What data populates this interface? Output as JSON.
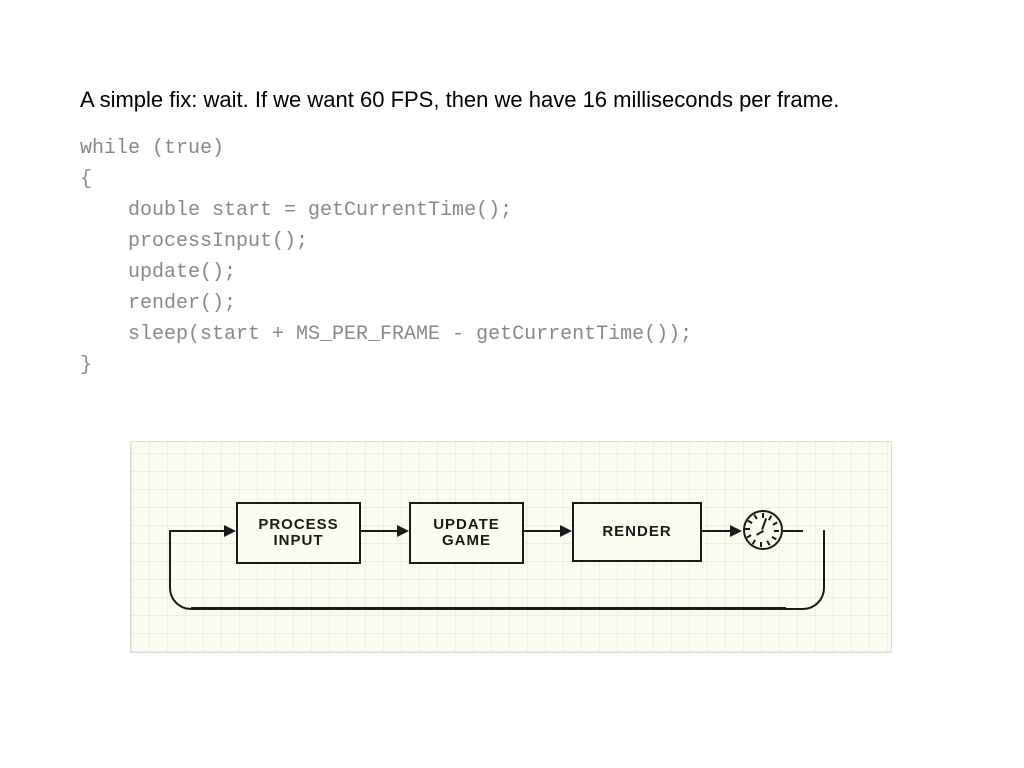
{
  "text": {
    "paragraph": "A simple fix: wait.  If we want 60 FPS, then we have 16 milliseconds per frame."
  },
  "code": {
    "line1": "while (true)",
    "line2": "{",
    "line3": "    double start = getCurrentTime();",
    "line4": "    processInput();",
    "line5": "    update();",
    "line6": "    render();",
    "line7": "    sleep(start + MS_PER_FRAME - getCurrentTime());",
    "line8": "}"
  },
  "diagram": {
    "box1": "PROCESS\nINPUT",
    "box2": "UPDATE\nGAME",
    "box3": "RENDER",
    "clock_name": "clock-icon"
  }
}
